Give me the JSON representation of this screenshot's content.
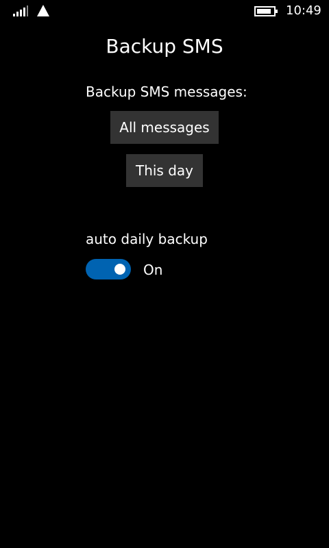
{
  "status_bar": {
    "time": "10:49",
    "icons": [
      "signal-icon",
      "network-icon",
      "battery-icon"
    ]
  },
  "page": {
    "title": "Backup SMS"
  },
  "backup": {
    "label": "Backup SMS messages:",
    "all_messages_label": "All messages",
    "this_day_label": "This day"
  },
  "auto_backup": {
    "label": "auto daily backup",
    "state_label": "On",
    "enabled": true,
    "accent_color": "#0063b1"
  },
  "colors": {
    "background": "#000000",
    "button_background": "#333333",
    "text": "#ffffff"
  }
}
